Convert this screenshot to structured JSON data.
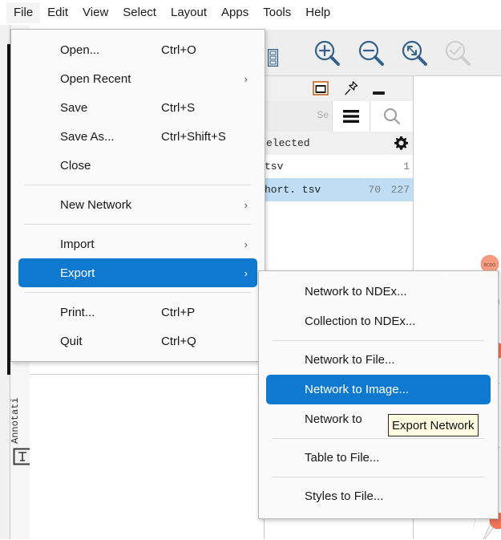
{
  "app": {
    "menubar": [
      {
        "label": "File",
        "active": true
      },
      {
        "label": "Edit",
        "active": false
      },
      {
        "label": "View",
        "active": false
      },
      {
        "label": "Select",
        "active": false
      },
      {
        "label": "Layout",
        "active": false
      },
      {
        "label": "Apps",
        "active": false
      },
      {
        "label": "Tools",
        "active": false
      },
      {
        "label": "Help",
        "active": false
      }
    ]
  },
  "toolbar": {
    "icons": [
      {
        "name": "table-icon",
        "title": "Table"
      },
      {
        "name": "zoom-in-icon",
        "title": "Zoom In"
      },
      {
        "name": "zoom-out-icon",
        "title": "Zoom Out"
      },
      {
        "name": "zoom-fit-icon",
        "title": "Fit Network to Window"
      },
      {
        "name": "zoom-selected-icon",
        "title": "Fit Selected",
        "disabled": true
      }
    ]
  },
  "panel": {
    "window_controls": [
      {
        "name": "float-icon",
        "label": "Float"
      },
      {
        "name": "pin-icon",
        "label": "Pin"
      },
      {
        "name": "minimize-icon",
        "label": "Minimize"
      }
    ],
    "search": {
      "placeholder": "Se",
      "value": ""
    },
    "controls": [
      {
        "name": "hamburger-icon",
        "label": "Options"
      },
      {
        "name": "search-icon",
        "label": "Search"
      }
    ],
    "table": {
      "header_text": "elected",
      "settings_icon": "gear-icon",
      "rows": [
        {
          "name": "tsv",
          "nodes": "",
          "edges": "1",
          "selected": false
        },
        {
          "name": "hort. tsv",
          "nodes": "70",
          "edges": "227",
          "selected": true
        }
      ]
    }
  },
  "sidebar": {
    "vertical_label": "Annotati",
    "icon": "annotation-icon"
  },
  "file_menu": {
    "items": [
      {
        "type": "item",
        "label": "Open...",
        "accel": "Ctrl+O",
        "arrow": false,
        "selected": false
      },
      {
        "type": "item",
        "label": "Open Recent",
        "accel": "",
        "arrow": true,
        "selected": false
      },
      {
        "type": "item",
        "label": "Save",
        "accel": "Ctrl+S",
        "arrow": false,
        "selected": false
      },
      {
        "type": "item",
        "label": "Save As...",
        "accel": "Ctrl+Shift+S",
        "arrow": false,
        "selected": false
      },
      {
        "type": "item",
        "label": "Close",
        "accel": "",
        "arrow": false,
        "selected": false
      },
      {
        "type": "separator"
      },
      {
        "type": "item",
        "label": "New Network",
        "accel": "",
        "arrow": true,
        "selected": false
      },
      {
        "type": "separator"
      },
      {
        "type": "item",
        "label": "Import",
        "accel": "",
        "arrow": true,
        "selected": false
      },
      {
        "type": "item",
        "label": "Export",
        "accel": "",
        "arrow": true,
        "selected": true
      },
      {
        "type": "separator"
      },
      {
        "type": "item",
        "label": "Print...",
        "accel": "Ctrl+P",
        "arrow": false,
        "selected": false
      },
      {
        "type": "item",
        "label": "Quit",
        "accel": "Ctrl+Q",
        "arrow": false,
        "selected": false
      }
    ]
  },
  "export_menu": {
    "items": [
      {
        "type": "item",
        "label": "Network to NDEx...",
        "selected": false
      },
      {
        "type": "item",
        "label": "Collection to NDEx...",
        "selected": false
      },
      {
        "type": "separator"
      },
      {
        "type": "item",
        "label": "Network to File...",
        "selected": false
      },
      {
        "type": "item",
        "label": "Network to Image...",
        "selected": true
      },
      {
        "type": "item",
        "label": "Network to",
        "selected": false
      },
      {
        "type": "separator"
      },
      {
        "type": "item",
        "label": "Table to File...",
        "selected": false
      },
      {
        "type": "separator"
      },
      {
        "type": "item",
        "label": "Styles to File...",
        "selected": false
      }
    ]
  },
  "tooltip": {
    "text": "Export Network"
  },
  "colors": {
    "menu_highlight": "#0f79d0",
    "row_selected": "#bfdef6",
    "tooltip_bg": "#fdfbdf",
    "node_fill": "#f79b80",
    "accent_icon": "#31688e"
  }
}
